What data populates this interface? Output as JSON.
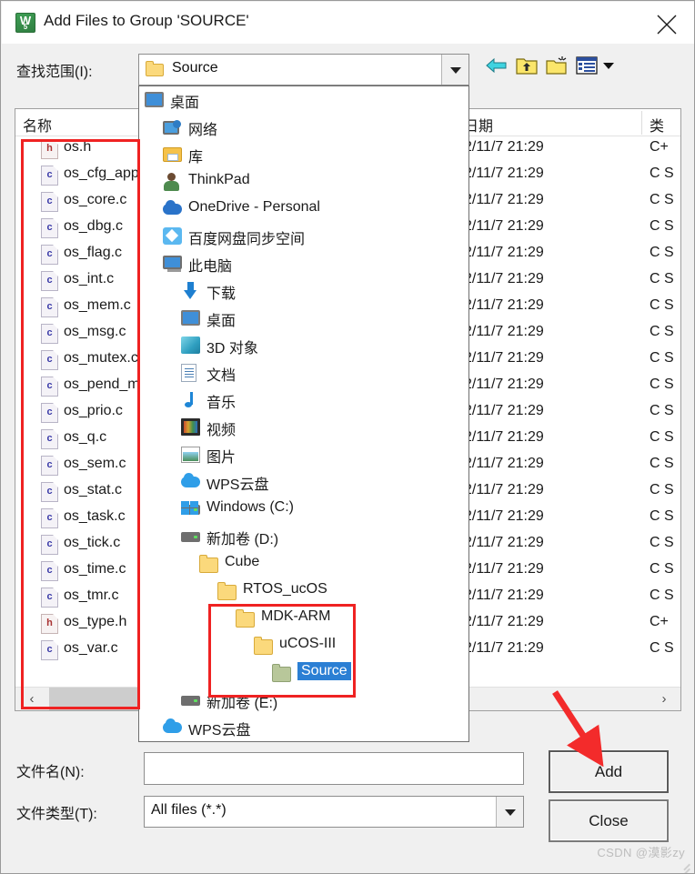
{
  "window": {
    "title": "Add Files to Group 'SOURCE'",
    "app_icon": "wps-5-icon",
    "close_icon": "close-icon"
  },
  "lookin": {
    "label": "查找范围(I):",
    "value": "Source",
    "dropdown_arrow_icon": "chevron-down-icon"
  },
  "toolbar": {
    "back_icon": "back-arrow-icon",
    "up_icon": "up-folder-icon",
    "new_folder_icon": "new-folder-icon",
    "views_icon": "views-list-icon",
    "views_arrow_icon": "chevron-down-icon"
  },
  "filelist": {
    "columns": [
      "名称",
      "日期",
      "类型"
    ],
    "column_type_clipped": "类",
    "rows": [
      {
        "name": "os.h",
        "kind": "h",
        "date": "2/11/7 21:29",
        "type": "C+"
      },
      {
        "name": "os_cfg_app.c",
        "kind": "c",
        "date": "2/11/7 21:29",
        "type": "C S"
      },
      {
        "name": "os_core.c",
        "kind": "c",
        "date": "2/11/7 21:29",
        "type": "C S"
      },
      {
        "name": "os_dbg.c",
        "kind": "c",
        "date": "2/11/7 21:29",
        "type": "C S"
      },
      {
        "name": "os_flag.c",
        "kind": "c",
        "date": "2/11/7 21:29",
        "type": "C S"
      },
      {
        "name": "os_int.c",
        "kind": "c",
        "date": "2/11/7 21:29",
        "type": "C S"
      },
      {
        "name": "os_mem.c",
        "kind": "c",
        "date": "2/11/7 21:29",
        "type": "C S"
      },
      {
        "name": "os_msg.c",
        "kind": "c",
        "date": "2/11/7 21:29",
        "type": "C S"
      },
      {
        "name": "os_mutex.c",
        "kind": "c",
        "date": "2/11/7 21:29",
        "type": "C S"
      },
      {
        "name": "os_pend_multi.c",
        "kind": "c",
        "date": "2/11/7 21:29",
        "type": "C S"
      },
      {
        "name": "os_prio.c",
        "kind": "c",
        "date": "2/11/7 21:29",
        "type": "C S"
      },
      {
        "name": "os_q.c",
        "kind": "c",
        "date": "2/11/7 21:29",
        "type": "C S"
      },
      {
        "name": "os_sem.c",
        "kind": "c",
        "date": "2/11/7 21:29",
        "type": "C S"
      },
      {
        "name": "os_stat.c",
        "kind": "c",
        "date": "2/11/7 21:29",
        "type": "C S"
      },
      {
        "name": "os_task.c",
        "kind": "c",
        "date": "2/11/7 21:29",
        "type": "C S"
      },
      {
        "name": "os_tick.c",
        "kind": "c",
        "date": "2/11/7 21:29",
        "type": "C S"
      },
      {
        "name": "os_time.c",
        "kind": "c",
        "date": "2/11/7 21:29",
        "type": "C S"
      },
      {
        "name": "os_tmr.c",
        "kind": "c",
        "date": "2/11/7 21:29",
        "type": "C S"
      },
      {
        "name": "os_type.h",
        "kind": "h",
        "date": "2/11/7 21:29",
        "type": "C+"
      },
      {
        "name": "os_var.c",
        "kind": "c",
        "date": "2/11/7 21:29",
        "type": "C S"
      }
    ],
    "hscroll": {
      "left_icon": "chevron-left-icon",
      "right_icon": "chevron-right-icon"
    }
  },
  "dropdown": {
    "items": [
      {
        "label": "桌面",
        "icon": "monitor-icon",
        "indent": 0,
        "selected": false
      },
      {
        "label": "网络",
        "icon": "network-icon",
        "indent": 1,
        "selected": false
      },
      {
        "label": "库",
        "icon": "library-icon",
        "indent": 1,
        "selected": false
      },
      {
        "label": "ThinkPad",
        "icon": "user-icon",
        "indent": 1,
        "selected": false
      },
      {
        "label": "OneDrive - Personal",
        "icon": "cloud-icon",
        "indent": 1,
        "selected": false
      },
      {
        "label": "百度网盘同步空间",
        "icon": "baidu-netdisk-icon",
        "indent": 1,
        "selected": false
      },
      {
        "label": "此电脑",
        "icon": "this-pc-icon",
        "indent": 1,
        "selected": false
      },
      {
        "label": "下载",
        "icon": "download-icon",
        "indent": 2,
        "selected": false
      },
      {
        "label": "桌面",
        "icon": "monitor-icon",
        "indent": 2,
        "selected": false
      },
      {
        "label": "3D 对象",
        "icon": "3d-object-icon",
        "indent": 2,
        "selected": false
      },
      {
        "label": "文档",
        "icon": "document-icon",
        "indent": 2,
        "selected": false
      },
      {
        "label": "音乐",
        "icon": "music-icon",
        "indent": 2,
        "selected": false
      },
      {
        "label": "视频",
        "icon": "video-icon",
        "indent": 2,
        "selected": false
      },
      {
        "label": "图片",
        "icon": "picture-icon",
        "indent": 2,
        "selected": false
      },
      {
        "label": "WPS云盘",
        "icon": "wps-cloud-icon",
        "indent": 2,
        "selected": false
      },
      {
        "label": "Windows (C:)",
        "icon": "windows-drive-icon",
        "indent": 2,
        "selected": false
      },
      {
        "label": "新加卷 (D:)",
        "icon": "drive-icon",
        "indent": 2,
        "selected": false
      },
      {
        "label": "Cube",
        "icon": "folder-icon",
        "indent": 3,
        "selected": false
      },
      {
        "label": "RTOS_ucOS",
        "icon": "folder-icon",
        "indent": 4,
        "selected": false
      },
      {
        "label": "MDK-ARM",
        "icon": "folder-icon",
        "indent": 5,
        "selected": false
      },
      {
        "label": "uCOS-III",
        "icon": "folder-icon",
        "indent": 6,
        "selected": false
      },
      {
        "label": "Source",
        "icon": "folder-open-icon",
        "indent": 7,
        "selected": true
      },
      {
        "label": "新加卷 (E:)",
        "icon": "drive-icon",
        "indent": 2,
        "selected": false
      },
      {
        "label": "WPS云盘",
        "icon": "wps-cloud-icon",
        "indent": 1,
        "selected": false
      }
    ]
  },
  "bottom": {
    "filename_label": "文件名(N):",
    "filename_value": "",
    "filetype_label": "文件类型(T):",
    "filetype_value": "All files (*.*)",
    "filetype_arrow_icon": "chevron-down-icon",
    "add_button": "Add",
    "close_button": "Close"
  },
  "annotations": {
    "highlight_color": "#ef2222",
    "arrow_icon": "red-arrow-pointing-to-add"
  },
  "watermark": "CSDN @漠影zy"
}
